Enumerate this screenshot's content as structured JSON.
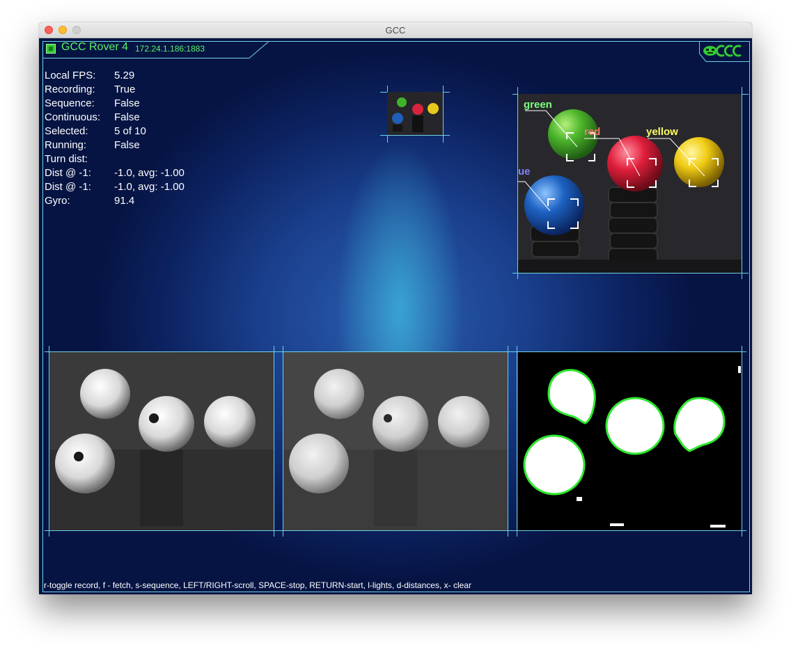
{
  "window": {
    "title": "GCC"
  },
  "header": {
    "rover_name": "GCC Rover 4",
    "address": "172.24.1.186:1883",
    "logo_text": "GCC"
  },
  "stats": [
    {
      "label": "Local FPS:",
      "value": "5.29"
    },
    {
      "label": "Recording:",
      "value": "True"
    },
    {
      "label": "Sequence:",
      "value": "False"
    },
    {
      "label": "Continuous:",
      "value": "False"
    },
    {
      "label": "Selected:",
      "value": "5 of 10"
    },
    {
      "label": "Running:",
      "value": "False"
    },
    {
      "label": "Turn dist:",
      "value": ""
    },
    {
      "label": "Dist @ -1:",
      "value": "-1.0, avg: -1.00"
    },
    {
      "label": "Dist @ -1:",
      "value": "-1.0, avg: -1.00"
    },
    {
      "label": "Gyro:",
      "value": "91.4"
    }
  ],
  "camera": {
    "labels": {
      "green": "green",
      "red": "red",
      "yellow": "yellow",
      "blue": "ue"
    }
  },
  "help_text": "r-toggle record, f - fetch, s-sequence, LEFT/RIGHT-scroll, SPACE-stop, RETURN-start, l-lights, d-distances, x- clear",
  "colors": {
    "accent_green": "#5cf06a",
    "frame_cyan": "#6fd3e6",
    "label_green": "#7dff7d",
    "label_red": "#ff7070",
    "label_yellow": "#ffff66",
    "label_blue": "#8080ff"
  }
}
